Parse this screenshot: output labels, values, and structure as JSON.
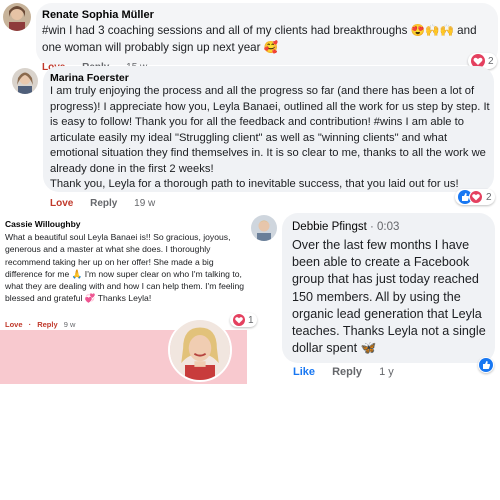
{
  "comments": [
    {
      "author": "Renate Sophia Müller",
      "text": "#win I had 3 coaching sessions and all of my clients had breakthroughs 😍🙌🙌 and one woman will probably sign up next year 🥰",
      "actions": {
        "love": "Love",
        "reply": "Reply",
        "time": "15 w"
      },
      "reactions": {
        "count": "2",
        "icons": [
          "love-heart-icon"
        ]
      }
    },
    {
      "author": "Marina Foerster",
      "text": "I am truly enjoying the process and all the progress so far (and there has been a lot of progress)! I appreciate how you, Leyla Banaei, outlined all the work for us step by step. It is easy to follow! Thank you for all the feedback and contribution! #wins I am able to articulate easily my ideal \"Struggling client\" as well as \"winning clients\" and what emotional situation they find themselves in. It is so clear to me, thanks to all the work we already done in the first 2 weeks!\nThank you, Leyla for a thorough path to inevitable success, that you laid out for us!",
      "actions": {
        "love": "Love",
        "reply": "Reply",
        "time": "19 w"
      },
      "reactions": {
        "count": "2",
        "icons": [
          "like-thumb-icon",
          "love-heart-icon"
        ]
      }
    },
    {
      "author": "Cassie Willoughby",
      "text": "What a beautiful soul Leyla Banaei is!! So gracious, joyous, generous and a master at what she does. I thoroughly recommend taking her up on her offer! She made a big difference for me 🙏 I'm now super clear on who I'm talking to, what they are dealing with and how I can help them. I'm feeling blessed and grateful 💞 Thanks Leyla!",
      "actions": {
        "love": "Love",
        "sep": "·",
        "reply": "Reply",
        "time": "9 w"
      },
      "reactions": {
        "count": "1",
        "icons": [
          "love-heart-icon"
        ]
      }
    },
    {
      "author": "Debbie Pfingst",
      "time_label": "· 0:03",
      "text": "Over the last few months I have been able to create a Facebook group that has just today reached 150 members. All by using the organic lead generation that Leyla teaches. Thanks Leyla not a single dollar spent 🦋",
      "actions": {
        "like": "Like",
        "reply": "Reply",
        "time": "1 y"
      },
      "reactions": {
        "icons": [
          "like-thumb-icon"
        ]
      }
    }
  ],
  "colors": {
    "love": "#e4405f",
    "like": "#1877f2",
    "bubble": "#f0f2f5",
    "pink_panel": "#f8c9cf"
  }
}
